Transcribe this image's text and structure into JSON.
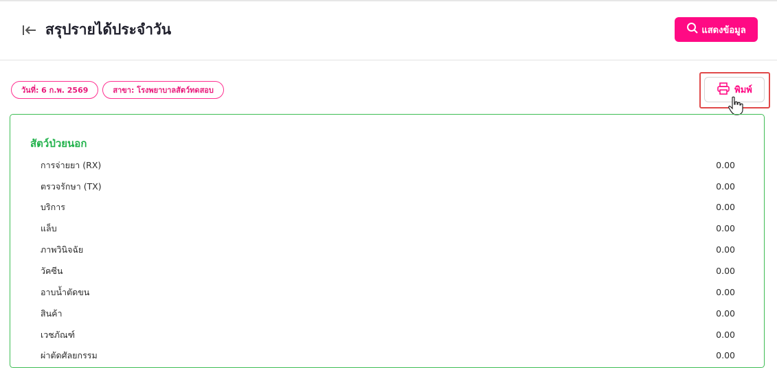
{
  "header": {
    "title": "สรุปรายได้ประจำวัน",
    "back_icon": "arrow-left-to-bar-icon",
    "show_button_label": "แสดงข้อมูล",
    "show_button_icon": "search-icon",
    "accent_color": "#ff0a84"
  },
  "filters": {
    "date_chip": "วันที่: 6 ก.พ. 2569",
    "branch_chip": "สาขา: โรงพยาบาลสัตว์ทดสอบ"
  },
  "print": {
    "label": "พิมพ์",
    "icon": "printer-icon"
  },
  "report": {
    "section_title": "สัตว์ป่วยนอก",
    "section_color": "#22b24c",
    "rows": [
      {
        "label": "การจ่ายยา (RX)",
        "value": "0.00"
      },
      {
        "label": "ตรวจรักษา (TX)",
        "value": "0.00"
      },
      {
        "label": "บริการ",
        "value": "0.00"
      },
      {
        "label": "แล็บ",
        "value": "0.00"
      },
      {
        "label": "ภาพวินิจฉัย",
        "value": "0.00"
      },
      {
        "label": "วัคซีน",
        "value": "0.00"
      },
      {
        "label": "อาบน้ำตัดขน",
        "value": "0.00"
      },
      {
        "label": "สินค้า",
        "value": "0.00"
      },
      {
        "label": "เวชภัณฑ์",
        "value": "0.00"
      },
      {
        "label": "ผ่าตัดศัลยกรรม",
        "value": "0.00"
      }
    ]
  }
}
